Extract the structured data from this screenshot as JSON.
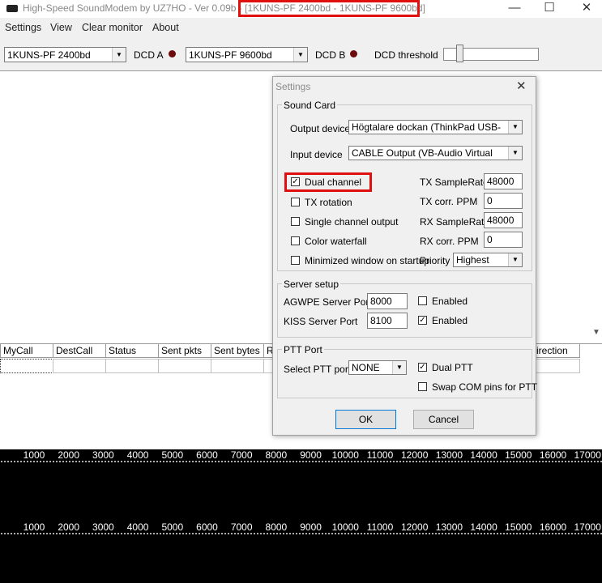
{
  "window": {
    "title": "High-Speed SoundModem by UZ7HO - Ver 0.09b - [1KUNS-PF 2400bd - 1KUNS-PF 9600bd]",
    "minimize": "—",
    "maximize": "☐",
    "close": "✕"
  },
  "menu": [
    "Settings",
    "View",
    "Clear monitor",
    "About"
  ],
  "toolbar": {
    "modem_a": "1KUNS-PF 2400bd",
    "dcd_a": "DCD A",
    "modem_b": "1KUNS-PF 9600bd",
    "dcd_b": "DCD B",
    "dcd_threshold": "DCD threshold",
    "dcd_threshold_level": 0.15
  },
  "table": {
    "columns": [
      "MyCall",
      "DestCall",
      "Status",
      "Sent pkts",
      "Sent bytes",
      "R",
      "irection"
    ]
  },
  "waterfall": {
    "scale_labels": [
      "1000",
      "2000",
      "3000",
      "4000",
      "5000",
      "6000",
      "7000",
      "8000",
      "9000",
      "10000",
      "11000",
      "12000",
      "13000",
      "14000",
      "15000",
      "16000",
      "17000"
    ]
  },
  "dialog": {
    "title": "Settings",
    "close": "✕",
    "sound_card": {
      "title": "Sound Card",
      "output_label": "Output device",
      "output_value": "Högtalare dockan (ThinkPad USB-",
      "input_label": "Input device",
      "input_value": "CABLE Output (VB-Audio Virtual",
      "dual_channel": "Dual channel",
      "tx_rotation": "TX rotation",
      "single_channel_output": "Single channel output",
      "color_waterfall": "Color waterfall",
      "minimized": "Minimized window on startup",
      "tx_samplerate_label": "TX SampleRate",
      "tx_samplerate": "48000",
      "tx_ppm_label": "TX corr. PPM",
      "tx_ppm": "0",
      "rx_samplerate_label": "RX SampleRate",
      "rx_samplerate": "48000",
      "rx_ppm_label": "RX corr. PPM",
      "rx_ppm": "0",
      "priority_label": "Priority",
      "priority_value": "Highest",
      "check_mark": "✓"
    },
    "server": {
      "title": "Server setup",
      "agwpe_label": "AGWPE Server Port",
      "agwpe_port": "8000",
      "agwpe_enabled": "Enabled",
      "kiss_label": "KISS Server Port",
      "kiss_port": "8100",
      "kiss_enabled": "Enabled"
    },
    "ptt": {
      "title": "PTT Port",
      "select_label": "Select PTT port",
      "select_value": "NONE",
      "dual_ptt": "Dual PTT",
      "swap_com": "Swap COM pins for PTT"
    },
    "ok": "OK",
    "cancel": "Cancel"
  },
  "colors": {
    "highlight": "#e01010",
    "led": "#6b0b0b"
  }
}
